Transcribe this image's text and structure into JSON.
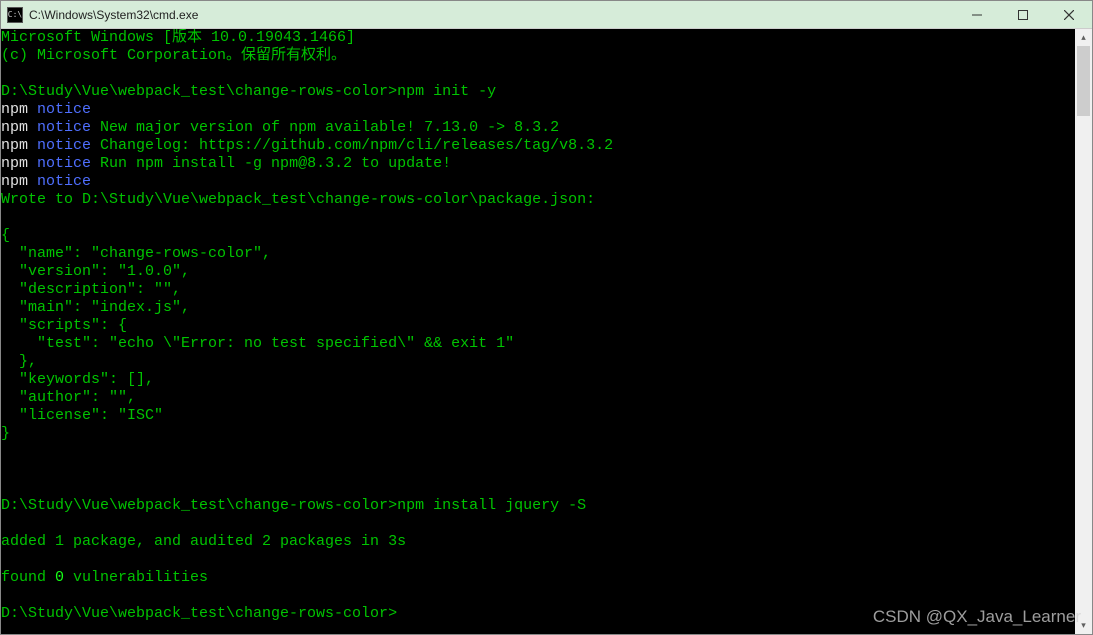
{
  "window": {
    "icon": "C:\\",
    "title": "C:\\Windows\\System32\\cmd.exe"
  },
  "header": {
    "line1": "Microsoft Windows [版本 10.0.19043.1466]",
    "line2": "(c) Microsoft Corporation。保留所有权利。"
  },
  "prompt1": {
    "path": "D:\\Study\\Vue\\webpack_test\\change-rows-color>",
    "cmd": "npm init -y"
  },
  "notices": [
    {
      "prefix": "npm ",
      "notice": "notice",
      "rest": ""
    },
    {
      "prefix": "npm ",
      "notice": "notice",
      "rest": " New major version of npm available! 7.13.0 -> 8.3.2"
    },
    {
      "prefix": "npm ",
      "notice": "notice",
      "rest": " Changelog: https://github.com/npm/cli/releases/tag/v8.3.2"
    },
    {
      "prefix": "npm ",
      "notice": "notice",
      "rest": " Run npm install -g npm@8.3.2 to update!"
    },
    {
      "prefix": "npm ",
      "notice": "notice",
      "rest": ""
    }
  ],
  "wrote": "Wrote to D:\\Study\\Vue\\webpack_test\\change-rows-color\\package.json:",
  "json": {
    "open": "{",
    "name": "  \"name\": \"change-rows-color\",",
    "version": "  \"version\": \"1.0.0\",",
    "description": "  \"description\": \"\",",
    "main": "  \"main\": \"index.js\",",
    "scripts_open": "  \"scripts\": {",
    "test": "    \"test\": \"echo \\\"Error: no test specified\\\" && exit 1\"",
    "scripts_close": "  },",
    "keywords": "  \"keywords\": [],",
    "author": "  \"author\": \"\",",
    "license": "  \"license\": \"ISC\"",
    "close": "}"
  },
  "prompt2": {
    "path": "D:\\Study\\Vue\\webpack_test\\change-rows-color>",
    "cmd": "npm install jquery -S"
  },
  "result": {
    "added": "added 1 package, and audited 2 packages in 3s",
    "vuln_pre": "found ",
    "vuln_num": "0",
    "vuln_post": " vulnerabilities"
  },
  "prompt3": {
    "path": "D:\\Study\\Vue\\webpack_test\\change-rows-color>"
  },
  "watermark": "CSDN @QX_Java_Learner"
}
